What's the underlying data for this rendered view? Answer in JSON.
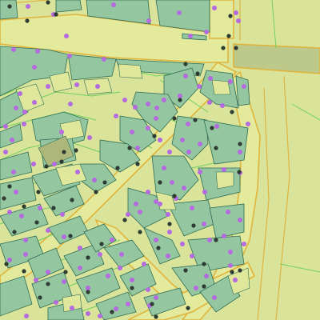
{
  "map": {
    "colors": {
      "background": "#d9e49a",
      "road_fill": "#e3ea9c",
      "road_edge": "#e0b43c",
      "parcel_line": "#6fcf5e",
      "building_fill": "#94c7a0",
      "building_stroke": "#2f6b55",
      "courtyard_fill": "#dfe79a",
      "dark_block_fill": "#aeb77a",
      "bridge_fill": "#bcc98a",
      "purple_point": "#b46be0",
      "dark_point": "#2e3b33"
    },
    "layers": [
      {
        "name": "roads"
      },
      {
        "name": "parcels"
      },
      {
        "name": "buildings"
      },
      {
        "name": "address-points-purple"
      },
      {
        "name": "address-points-dark"
      }
    ]
  }
}
